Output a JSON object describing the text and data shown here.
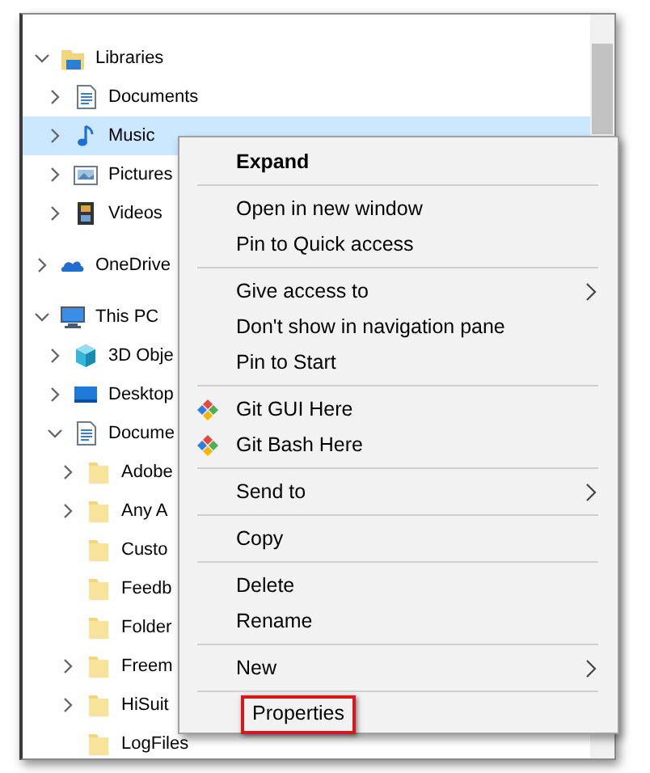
{
  "navigation_tree": [
    {
      "label": "Libraries",
      "kind": "library",
      "expandable": true,
      "expanded": true,
      "selected": false,
      "children": [
        {
          "label": "Documents",
          "kind": "documents",
          "expandable": true,
          "expanded": false,
          "selected": false
        },
        {
          "label": "Music",
          "kind": "music",
          "expandable": true,
          "expanded": false,
          "selected": true
        },
        {
          "label": "Pictures",
          "kind": "pictures",
          "expandable": true,
          "expanded": false,
          "selected": false
        },
        {
          "label": "Videos",
          "kind": "videos",
          "expandable": true,
          "expanded": false,
          "selected": false
        }
      ]
    },
    {
      "label": "OneDrive",
      "kind": "onedrive",
      "expandable": true,
      "expanded": false,
      "selected": false,
      "gap": true
    },
    {
      "label": "This PC",
      "kind": "pc",
      "expandable": true,
      "expanded": true,
      "selected": false,
      "gap": true,
      "children": [
        {
          "label": "3D Obje",
          "kind": "objects3d",
          "expandable": true,
          "expanded": false,
          "selected": false
        },
        {
          "label": "Desktop",
          "kind": "desktop",
          "expandable": true,
          "expanded": false,
          "selected": false
        },
        {
          "label": "Docume",
          "kind": "documents",
          "expandable": true,
          "expanded": true,
          "selected": false,
          "children": [
            {
              "label": "Adobe",
              "kind": "folder",
              "expandable": true,
              "expanded": false,
              "selected": false
            },
            {
              "label": "Any A",
              "kind": "folder",
              "expandable": true,
              "expanded": false,
              "selected": false
            },
            {
              "label": "Custo",
              "kind": "folder",
              "expandable": false,
              "selected": false
            },
            {
              "label": "Feedb",
              "kind": "folder",
              "expandable": false,
              "selected": false
            },
            {
              "label": "Folder",
              "kind": "folder",
              "expandable": false,
              "selected": false
            },
            {
              "label": "Freem",
              "kind": "folder",
              "expandable": true,
              "expanded": false,
              "selected": false
            },
            {
              "label": "HiSuit",
              "kind": "folder",
              "expandable": true,
              "expanded": false,
              "selected": false
            },
            {
              "label": "LogFiles",
              "kind": "folder",
              "expandable": false,
              "selected": false
            }
          ]
        }
      ]
    }
  ],
  "context_menu": [
    {
      "kind": "item",
      "label": "Expand",
      "default": true
    },
    {
      "kind": "separator"
    },
    {
      "kind": "item",
      "label": "Open in new window"
    },
    {
      "kind": "item",
      "label": "Pin to Quick access"
    },
    {
      "kind": "separator"
    },
    {
      "kind": "item",
      "label": "Give access to",
      "submenu": true
    },
    {
      "kind": "item",
      "label": "Don't show in navigation pane"
    },
    {
      "kind": "item",
      "label": "Pin to Start"
    },
    {
      "kind": "separator"
    },
    {
      "kind": "git_item",
      "label": "Git GUI Here"
    },
    {
      "kind": "git_item",
      "label": "Git Bash Here"
    },
    {
      "kind": "separator"
    },
    {
      "kind": "item",
      "label": "Send to",
      "submenu": true
    },
    {
      "kind": "separator"
    },
    {
      "kind": "item",
      "label": "Copy"
    },
    {
      "kind": "separator"
    },
    {
      "kind": "item",
      "label": "Delete"
    },
    {
      "kind": "item",
      "label": "Rename"
    },
    {
      "kind": "separator"
    },
    {
      "kind": "item",
      "label": "New",
      "submenu": true
    },
    {
      "kind": "separator"
    },
    {
      "kind": "item",
      "label": "Properties",
      "highlighted": true
    }
  ]
}
